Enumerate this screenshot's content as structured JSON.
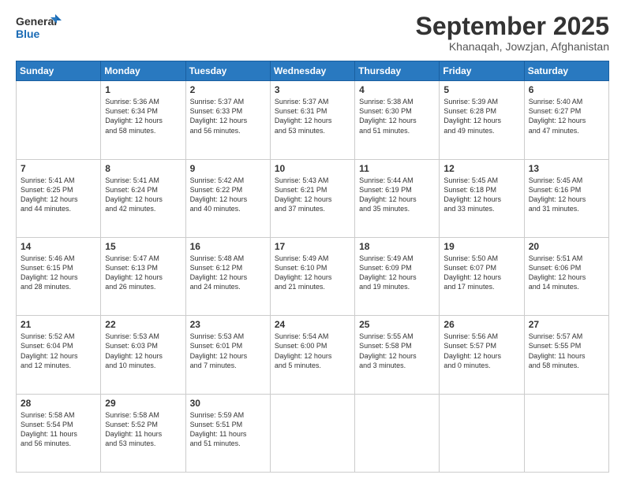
{
  "logo": {
    "line1": "General",
    "line2": "Blue"
  },
  "title": "September 2025",
  "subtitle": "Khanaqah, Jowzjan, Afghanistan",
  "weekdays": [
    "Sunday",
    "Monday",
    "Tuesday",
    "Wednesday",
    "Thursday",
    "Friday",
    "Saturday"
  ],
  "weeks": [
    [
      {
        "day": "",
        "info": ""
      },
      {
        "day": "1",
        "info": "Sunrise: 5:36 AM\nSunset: 6:34 PM\nDaylight: 12 hours\nand 58 minutes."
      },
      {
        "day": "2",
        "info": "Sunrise: 5:37 AM\nSunset: 6:33 PM\nDaylight: 12 hours\nand 56 minutes."
      },
      {
        "day": "3",
        "info": "Sunrise: 5:37 AM\nSunset: 6:31 PM\nDaylight: 12 hours\nand 53 minutes."
      },
      {
        "day": "4",
        "info": "Sunrise: 5:38 AM\nSunset: 6:30 PM\nDaylight: 12 hours\nand 51 minutes."
      },
      {
        "day": "5",
        "info": "Sunrise: 5:39 AM\nSunset: 6:28 PM\nDaylight: 12 hours\nand 49 minutes."
      },
      {
        "day": "6",
        "info": "Sunrise: 5:40 AM\nSunset: 6:27 PM\nDaylight: 12 hours\nand 47 minutes."
      }
    ],
    [
      {
        "day": "7",
        "info": "Sunrise: 5:41 AM\nSunset: 6:25 PM\nDaylight: 12 hours\nand 44 minutes."
      },
      {
        "day": "8",
        "info": "Sunrise: 5:41 AM\nSunset: 6:24 PM\nDaylight: 12 hours\nand 42 minutes."
      },
      {
        "day": "9",
        "info": "Sunrise: 5:42 AM\nSunset: 6:22 PM\nDaylight: 12 hours\nand 40 minutes."
      },
      {
        "day": "10",
        "info": "Sunrise: 5:43 AM\nSunset: 6:21 PM\nDaylight: 12 hours\nand 37 minutes."
      },
      {
        "day": "11",
        "info": "Sunrise: 5:44 AM\nSunset: 6:19 PM\nDaylight: 12 hours\nand 35 minutes."
      },
      {
        "day": "12",
        "info": "Sunrise: 5:45 AM\nSunset: 6:18 PM\nDaylight: 12 hours\nand 33 minutes."
      },
      {
        "day": "13",
        "info": "Sunrise: 5:45 AM\nSunset: 6:16 PM\nDaylight: 12 hours\nand 31 minutes."
      }
    ],
    [
      {
        "day": "14",
        "info": "Sunrise: 5:46 AM\nSunset: 6:15 PM\nDaylight: 12 hours\nand 28 minutes."
      },
      {
        "day": "15",
        "info": "Sunrise: 5:47 AM\nSunset: 6:13 PM\nDaylight: 12 hours\nand 26 minutes."
      },
      {
        "day": "16",
        "info": "Sunrise: 5:48 AM\nSunset: 6:12 PM\nDaylight: 12 hours\nand 24 minutes."
      },
      {
        "day": "17",
        "info": "Sunrise: 5:49 AM\nSunset: 6:10 PM\nDaylight: 12 hours\nand 21 minutes."
      },
      {
        "day": "18",
        "info": "Sunrise: 5:49 AM\nSunset: 6:09 PM\nDaylight: 12 hours\nand 19 minutes."
      },
      {
        "day": "19",
        "info": "Sunrise: 5:50 AM\nSunset: 6:07 PM\nDaylight: 12 hours\nand 17 minutes."
      },
      {
        "day": "20",
        "info": "Sunrise: 5:51 AM\nSunset: 6:06 PM\nDaylight: 12 hours\nand 14 minutes."
      }
    ],
    [
      {
        "day": "21",
        "info": "Sunrise: 5:52 AM\nSunset: 6:04 PM\nDaylight: 12 hours\nand 12 minutes."
      },
      {
        "day": "22",
        "info": "Sunrise: 5:53 AM\nSunset: 6:03 PM\nDaylight: 12 hours\nand 10 minutes."
      },
      {
        "day": "23",
        "info": "Sunrise: 5:53 AM\nSunset: 6:01 PM\nDaylight: 12 hours\nand 7 minutes."
      },
      {
        "day": "24",
        "info": "Sunrise: 5:54 AM\nSunset: 6:00 PM\nDaylight: 12 hours\nand 5 minutes."
      },
      {
        "day": "25",
        "info": "Sunrise: 5:55 AM\nSunset: 5:58 PM\nDaylight: 12 hours\nand 3 minutes."
      },
      {
        "day": "26",
        "info": "Sunrise: 5:56 AM\nSunset: 5:57 PM\nDaylight: 12 hours\nand 0 minutes."
      },
      {
        "day": "27",
        "info": "Sunrise: 5:57 AM\nSunset: 5:55 PM\nDaylight: 11 hours\nand 58 minutes."
      }
    ],
    [
      {
        "day": "28",
        "info": "Sunrise: 5:58 AM\nSunset: 5:54 PM\nDaylight: 11 hours\nand 56 minutes."
      },
      {
        "day": "29",
        "info": "Sunrise: 5:58 AM\nSunset: 5:52 PM\nDaylight: 11 hours\nand 53 minutes."
      },
      {
        "day": "30",
        "info": "Sunrise: 5:59 AM\nSunset: 5:51 PM\nDaylight: 11 hours\nand 51 minutes."
      },
      {
        "day": "",
        "info": ""
      },
      {
        "day": "",
        "info": ""
      },
      {
        "day": "",
        "info": ""
      },
      {
        "day": "",
        "info": ""
      }
    ]
  ]
}
